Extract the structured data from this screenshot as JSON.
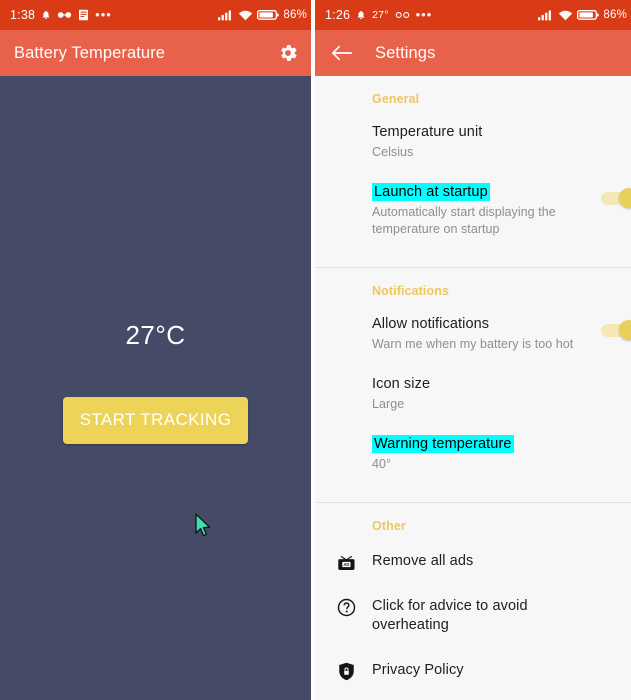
{
  "colors": {
    "status_bar": "#DA3B17",
    "app_bar": "#E8614A",
    "left_body": "#454B66",
    "accent_yellow": "#EDD358",
    "section_header": "#EFC75E",
    "highlight_cyan": "#00FFFF",
    "settings_bg": "#F7F7F8",
    "cursor": "#3FE0B0"
  },
  "left_panel": {
    "status_bar": {
      "clock": "1:38",
      "icons": [
        "bell-icon",
        "glasses-icon",
        "document-icon",
        "overflow-dots-icon"
      ],
      "right_icons": [
        "signal-icon",
        "wifi-icon",
        "battery-icon"
      ],
      "battery_percent": "86%"
    },
    "app_bar": {
      "title": "Battery Temperature",
      "settings_icon": "gear-icon"
    },
    "body": {
      "temperature": "27°C",
      "track_button": "START TRACKING"
    }
  },
  "right_panel": {
    "status_bar": {
      "clock": "1:26",
      "temperature": "27°",
      "icons": [
        "bell-icon",
        "glasses-icon",
        "overflow-dots-icon"
      ],
      "right_icons": [
        "signal-icon",
        "wifi-icon",
        "battery-icon"
      ],
      "battery_percent": "86%"
    },
    "app_bar": {
      "back_icon": "arrow-left-icon",
      "title": "Settings"
    },
    "sections": [
      {
        "title": "General",
        "rows": [
          {
            "title": "Temperature unit",
            "subtitle": "Celsius",
            "highlighted": false,
            "control": "none"
          },
          {
            "title": "Launch at startup",
            "subtitle": "Automatically start displaying the temperature on startup",
            "highlighted": true,
            "control": "toggle",
            "toggle_state": "on"
          }
        ]
      },
      {
        "title": "Notifications",
        "rows": [
          {
            "title": "Allow notifications",
            "subtitle": "Warn me when my battery is too hot",
            "highlighted": false,
            "control": "toggle",
            "toggle_state": "on"
          },
          {
            "title": "Icon size",
            "subtitle": "Large",
            "highlighted": false,
            "control": "none"
          },
          {
            "title": "Warning temperature",
            "subtitle": "40°",
            "highlighted": true,
            "control": "none"
          }
        ]
      },
      {
        "title": "Other",
        "rows": [
          {
            "title": "Remove all ads",
            "icon": "tv-ad-icon"
          },
          {
            "title": "Click for advice to avoid overheating",
            "icon": "help-circle-icon"
          },
          {
            "title": "Privacy Policy",
            "icon": "shield-lock-icon"
          }
        ]
      }
    ]
  }
}
